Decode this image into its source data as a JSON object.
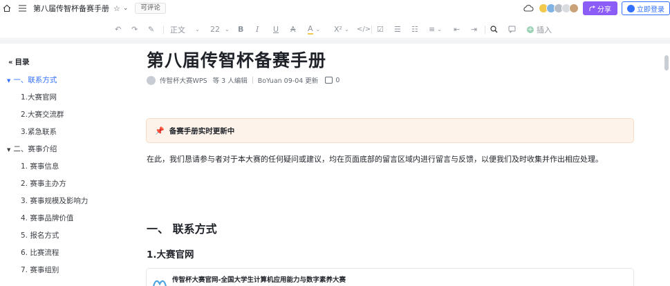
{
  "header": {
    "doc_name": "第八届传智杯备赛手册",
    "permission_badge": "可评论",
    "share_label": "分享",
    "login_label": "立即登录"
  },
  "toolbar": {
    "paragraph_style": "正文",
    "font_size": "22",
    "insert_label": "插入"
  },
  "outline": {
    "title": "目录",
    "items": [
      {
        "label": "一、联系方式",
        "level": 1,
        "active": true
      },
      {
        "label": "1.大赛官网",
        "level": 2
      },
      {
        "label": "2.大赛交流群",
        "level": 2
      },
      {
        "label": "3.紧急联系",
        "level": 2
      },
      {
        "label": "二、赛事介绍",
        "level": 1
      },
      {
        "label": "1. 赛事信息",
        "level": 2
      },
      {
        "label": "2. 赛事主办方",
        "level": 2
      },
      {
        "label": "3. 赛事规模及影响力",
        "level": 2
      },
      {
        "label": "4. 赛事品牌价值",
        "level": 2
      },
      {
        "label": "5. 报名方式",
        "level": 2
      },
      {
        "label": "6. 比赛流程",
        "level": 2
      },
      {
        "label": "7. 赛事组别",
        "level": 2
      }
    ]
  },
  "document": {
    "title": "第八届传智杯备赛手册",
    "meta": {
      "owner": "传智杯大赛WPS",
      "editors": "等 3 人编辑",
      "updated_by": "BoYuan 09-04 更新",
      "comments": "0"
    },
    "callout": "备赛手册实时更新中",
    "paragraph": "在此，我们恳请参与者对于本大赛的任何疑问或建议，均在页面底部的留言区域内进行留言与反馈，以便我们及时收集并作出相应处理。",
    "heading_1": "一、 联系方式",
    "heading_2": "1.大赛官网",
    "link_card_title": "传智杯大赛官网-全国大学生计算机应用能力与数字素养大赛"
  },
  "colors": {
    "accent": "#3370ff",
    "share": "#8b5cf6",
    "callout_bg": "#fdf3ea"
  }
}
